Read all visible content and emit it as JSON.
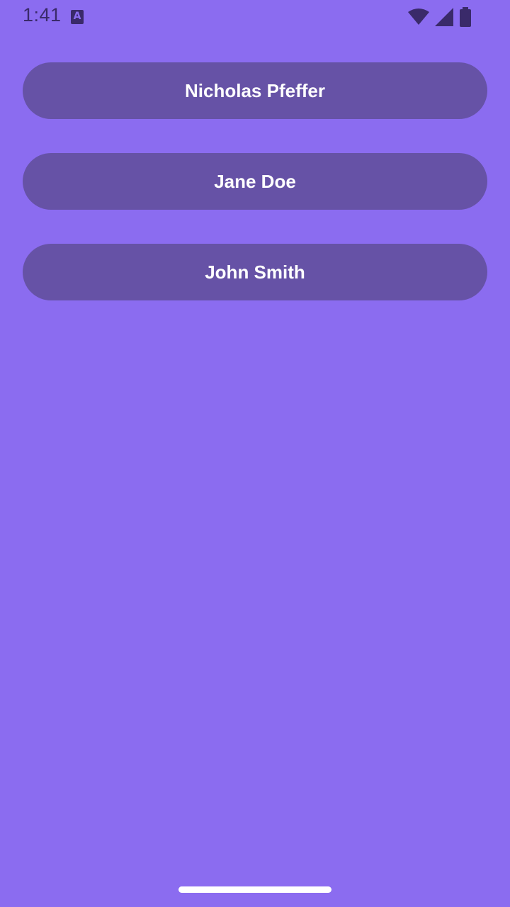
{
  "status_bar": {
    "time": "1:41",
    "notification_icon": "text-accessibility-icon",
    "icons": [
      "wifi-icon",
      "signal-icon",
      "battery-icon"
    ]
  },
  "people": [
    {
      "name": "Nicholas Pfeffer"
    },
    {
      "name": "Jane Doe"
    },
    {
      "name": "John Smith"
    }
  ],
  "colors": {
    "background": "#8b6cf0",
    "button": "#6652a6",
    "button_text": "#ffffff",
    "status_icons": "#3a2a6a"
  }
}
